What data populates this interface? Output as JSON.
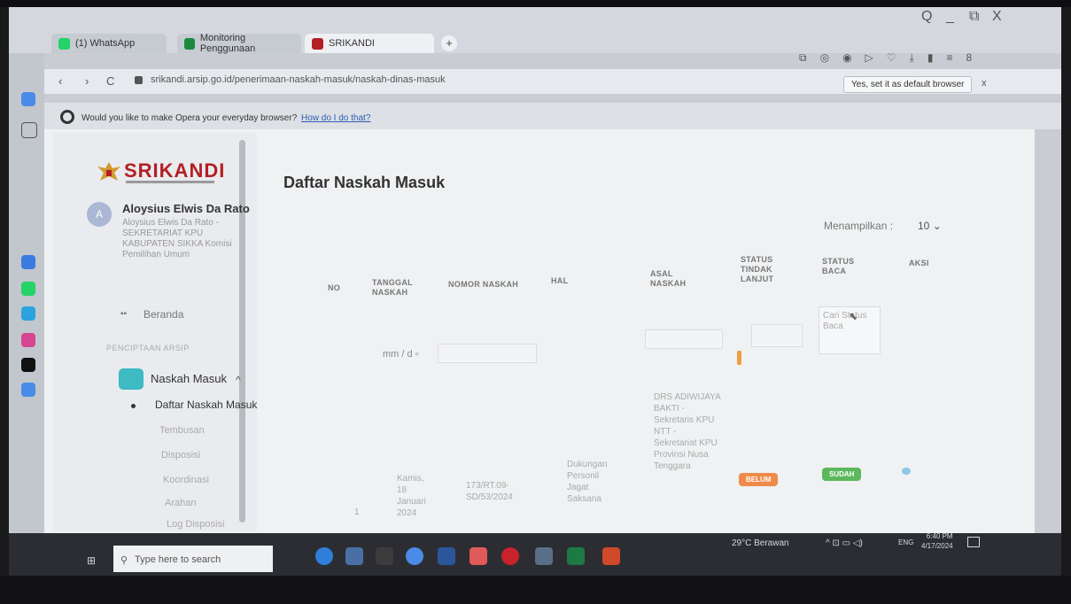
{
  "browser": {
    "tabs": [
      {
        "label": "(1) WhatsApp",
        "color": "#25d366"
      },
      {
        "label": "Monitoring Penggunaan",
        "color": "#1b8a3c"
      },
      {
        "label": "SRIKANDI",
        "color": "#b31f24"
      }
    ],
    "new_tab": "+",
    "window_controls": {
      "search": "Q",
      "minimize": "_",
      "restore": "⧉",
      "close": "X"
    },
    "url": "srikandi.arsip.go.id/penerimaan-naskah-masuk/naskah-dinas-masuk",
    "default_browser_button": "Yes, set it as default browser",
    "close_x": "x",
    "infobar_text": "Would you like to make Opera your everyday browser?",
    "infobar_link": "How do I do that?",
    "nav": {
      "back": "‹",
      "forward": "›",
      "reload": "C"
    }
  },
  "app": {
    "logo_text": "SRIKANDI",
    "user": {
      "initial": "A",
      "name": "Aloysius Elwis Da Rato",
      "meta": "Aloysius Elwis Da Rato - SEKRETARIAT KPU KABUPATEN SIKKA Komisi Pemilihan Umum"
    },
    "menu": {
      "beranda": "Beranda",
      "section": "PENCIPTAAN ARSIP",
      "naskah_masuk": "Naskah Masuk",
      "chevron": "^",
      "sub": [
        "Daftar Naskah Masuk",
        "Tembusan",
        "Disposisi",
        "Koordinasi",
        "Arahan",
        "Log Disposisi"
      ]
    }
  },
  "main": {
    "title": "Daftar Naskah Masuk",
    "show_label": "Menampilkan :",
    "show_value": "10",
    "columns": [
      "NO",
      "TANGGAL NASKAH",
      "NOMOR NASKAH",
      "HAL",
      "ASAL NASKAH",
      "STATUS TINDAK LANJUT",
      "STATUS BACA",
      "AKSI"
    ],
    "filters": {
      "date": "mm / d",
      "status_baca_placeholder": "Cari Status Baca"
    },
    "rows": [
      {
        "no": "1",
        "tanggal": "Kamis, 18 Januari 2024",
        "nomor": "173/RT.09-SD/53/2024",
        "hal": "Dukungan Personil Jagat Saksana",
        "asal": "DRS ADIWIJAYA BAKTI - Sekretaris KPU NTT - Sekretariat KPU Provinsi Nusa Tenggara",
        "tindak_lanjut": "BELUM",
        "baca": "SUDAH"
      }
    ]
  },
  "taskbar": {
    "search_placeholder": "Type here to search",
    "weather": "29°C Berawan",
    "lang": "ENG",
    "time": "6:40 PM",
    "date": "4/17/2024"
  },
  "colors": {
    "accent_red": "#b31f24",
    "badge_belum": "#ef8a4a",
    "badge_sudah": "#5cb85c",
    "menu_teal": "#3dbac2"
  }
}
